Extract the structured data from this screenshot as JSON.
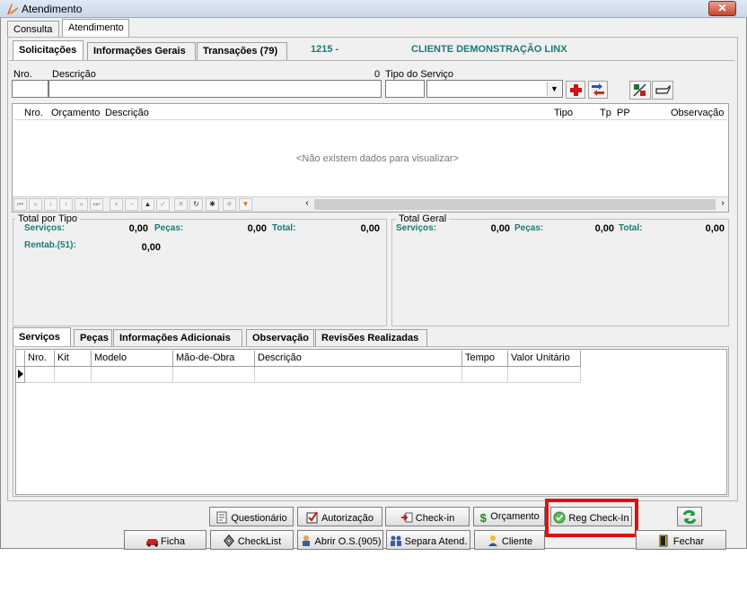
{
  "window": {
    "title": "Atendimento",
    "close_label": "✕"
  },
  "top_tabs": [
    {
      "label": "Consulta"
    },
    {
      "label": "Atendimento"
    }
  ],
  "sub_tabs": [
    {
      "label": "Solicitações"
    },
    {
      "label": "Informações Gerais"
    },
    {
      "label": "Transações (79)"
    }
  ],
  "header_info": {
    "code": "1215 -",
    "client": "CLIENTE DEMONSTRAÇÃO LINX"
  },
  "form": {
    "nro_label": "Nro.",
    "descricao_label": "Descrição",
    "count_value": "0",
    "tipo_servico_label": "Tipo do Serviço",
    "nro_value": "",
    "descricao_value": "",
    "tipo_value": "",
    "tipo_select_value": ""
  },
  "request_grid": {
    "columns": [
      "Nro.",
      "Orçamento",
      "Descrição",
      "Tipo",
      "Tp",
      "PP",
      "Observação"
    ],
    "empty_message": "<Não existem dados para visualizar>"
  },
  "totals_type": {
    "legend": "Total por Tipo",
    "servicos_label": "Serviços:",
    "servicos_value": "0,00",
    "pecas_label": "Peças:",
    "pecas_value": "0,00",
    "total_label": "Total:",
    "total_value": "0,00",
    "rentab_label": "Rentab.(51):",
    "rentab_value": "0,00"
  },
  "totals_general": {
    "legend": "Total Geral",
    "servicos_label": "Serviços:",
    "servicos_value": "0,00",
    "pecas_label": "Peças:",
    "pecas_value": "0,00",
    "total_label": "Total:",
    "total_value": "0,00"
  },
  "bottom_tabs": [
    {
      "label": "Serviços"
    },
    {
      "label": "Peças"
    },
    {
      "label": "Informações Adicionais"
    },
    {
      "label": "Observação"
    },
    {
      "label": "Revisões Realizadas"
    }
  ],
  "services_grid": {
    "columns": [
      "Nro.",
      "Kit",
      "Modelo",
      "Mão-de-Obra",
      "Descrição",
      "Tempo",
      "Valor Unitário"
    ]
  },
  "buttons": {
    "questionario": "Questionário",
    "autorizacao": "Autorização",
    "checkin": "Check-in",
    "orcamento": "Orçamento",
    "reg_checkin": "Reg Check-In",
    "ficha": "Ficha",
    "checklist": "CheckList",
    "abrir_os": "Abrir O.S.(905)",
    "separa_atend": "Separa Atend.",
    "cliente": "Cliente",
    "fechar": "Fechar"
  },
  "colors": {
    "accent_teal": "#1a7a7a",
    "highlight_red": "#e01010"
  }
}
